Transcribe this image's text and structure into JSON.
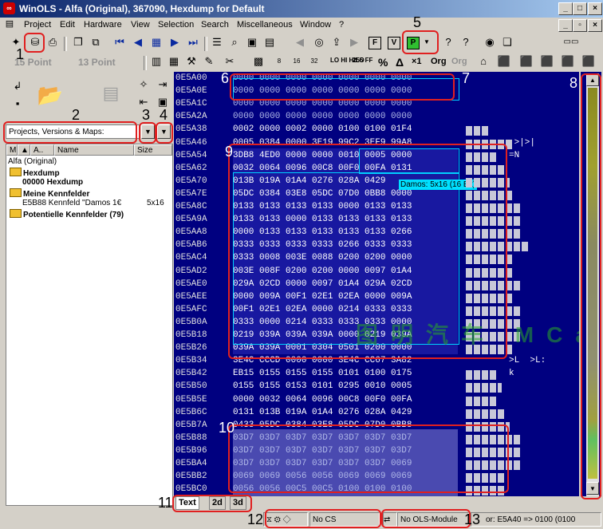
{
  "window": {
    "title": "WinOLS - Alfa (Original), 367090, Hexdump for Default",
    "icon": "winols-app-icon",
    "buttons": [
      "_",
      "□",
      "×"
    ]
  },
  "menu": [
    "Project",
    "Edit",
    "Hardware",
    "View",
    "Selection",
    "Search",
    "Miscellaneous",
    "Window",
    "?"
  ],
  "toolbar2": {
    "point_a": "15 Point",
    "point_b": "13 Point",
    "btn_hilo": "LO HI HILO",
    "btn_255": "255 FF",
    "btn_pct": "%",
    "btn_delta": "Δ",
    "btn_x1": "×1",
    "btn_org": "Org",
    "btn_org2": "Org"
  },
  "left": {
    "select_value": "Projects, Versions & Maps:",
    "columns": [
      "M",
      "A..",
      "Name",
      "Size"
    ],
    "tree": [
      {
        "label": "Alfa (Original)",
        "bold": false
      },
      {
        "label": "Hexdump",
        "bold": true
      },
      {
        "label": "00000  Hexdump",
        "bold": true
      },
      {
        "label": "Meine Kennfelder",
        "bold": true
      },
      {
        "label": "E5B88    Kennfeld \"Damos 1€",
        "size": "5x16",
        "bold": false
      },
      {
        "label": "Potentielle Kennfelder (79)",
        "bold": true
      }
    ]
  },
  "hex": {
    "addresses": [
      "0E5A00",
      "0E5A0E",
      "0E5A1C",
      "0E5A2A",
      "0E5A38",
      "0E5A46",
      "0E5A54",
      "0E5A62",
      "0E5A70",
      "0E5A7E",
      "0E5A8C",
      "0E5A9A",
      "0E5AA8",
      "0E5AB6",
      "0E5AC4",
      "0E5AD2",
      "0E5AE0",
      "0E5AEE",
      "0E5AFC",
      "0E5B0A",
      "0E5B18",
      "0E5B26",
      "0E5B34",
      "0E5B42",
      "0E5B50",
      "0E5B5E",
      "0E5B6C",
      "0E5B7A",
      "0E5B88",
      "0E5B96",
      "0E5BA4",
      "0E5BB2",
      "0E5BC0"
    ],
    "rows": [
      "0000 0000 0000 0000 0000 0000 0000",
      "0000 0000 0000 0000 0000 0000 0000",
      "0000 0000 0000 0000 0000 0000 0000",
      "0000 0000 0000 0000 0000 0000 0000",
      "0002 0000 0002 0000 0100 0100 01F4",
      "0005 0384 0000 3E19 99C2 3EF9 99A8",
      "3DB8 4ED0 0000 0000 0010 0005 0000",
      "0032 0064 0096 00C8 00F0 00FA 0131",
      "013B 019A 01A4 0276 028A 0429",
      "05DC 0384 03E8 05DC 07D0 0BB8 0000",
      "0133 0133 0133 0133 0000 0133 0133",
      "0133 0133 0000 0133 0133 0133 0133",
      "0000 0133 0133 0133 0133 0133 0266",
      "0333 0333 0333 0333 0266 0333 0333",
      "0333 0008 003E 0088 0200 0200 0000",
      "003E 008F 0200 0200 0000 0097 01A4",
      "029A 02CD 0000 0097 01A4 029A 02CD",
      "0000 009A 00F1 02E1 02EA 0000 009A",
      "00F1 02E1 02EA 0000 0214 0333 0333",
      "0333 0000 0214 0333 0333 0333 0000",
      "0219 039A 039A 039A 0000 0219 039A",
      "039A 039A 0001 0304 0501 0200 0000",
      "3E4C CCCD 0000 0000 3E4C CC67 3A82",
      "EB15 0155 0155 0155 0101 0100 0175",
      "0155 0155 0153 0101 0295 0010 0005",
      "0000 0032 0064 0096 00C8 00F0 00FA",
      "0131 013B 019A 01A4 0276 028A 0429",
      "0433 05DC 0384 03E8 05DC 07D0 0BB8",
      "03D7 03D7 03D7 03D7 03D7 03D7 03D7",
      "03D7 03D7 03D7 03D7 03D7 03D7 03D7",
      "03D7 03D7 03D7 03D7 03D7 03D7 0069",
      "0069 0069 0056 0056 0069 0069 0069",
      "0056 0056 00C5 00C5 0100 0100 0100"
    ],
    "tooltip": "Damos: 5x16 (16 Bit)",
    "ascii": [
      {
        "row": 5,
        "text": " >|>|"
      },
      {
        "row": 6,
        "text": "=N"
      },
      {
        "row": 22,
        "text": ">L  >L:"
      },
      {
        "row": 23,
        "text": "k"
      }
    ]
  },
  "tabs": [
    "Text",
    "2d",
    "3d"
  ],
  "status": {
    "cs": "No CS",
    "ols": "No OLS-Module",
    "cursor": "or: E5A40 => 0100 (0100"
  },
  "annotations": [
    "1",
    "2",
    "3",
    "4",
    "5",
    "6",
    "7",
    "8",
    "9",
    "10",
    "11",
    "12",
    "13"
  ],
  "watermark": "图明汽车 MCar",
  "colors": {
    "hex_bg": "#000080",
    "annotation": "#e02020",
    "selection": "#00d0ff"
  }
}
